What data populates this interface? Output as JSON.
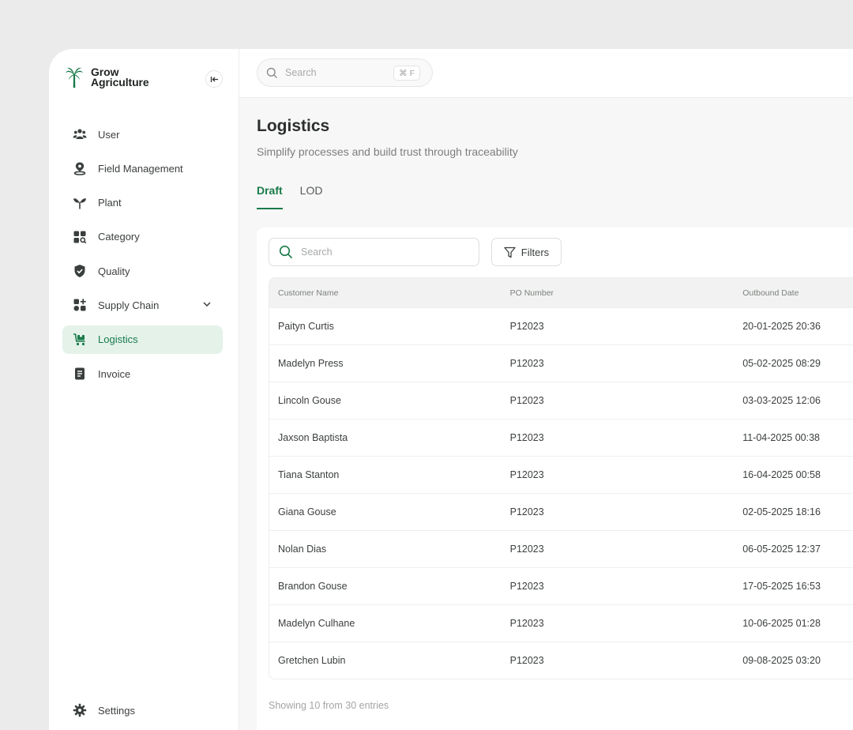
{
  "brand": {
    "line1": "Grow",
    "line2": "Agriculture"
  },
  "top_search": {
    "placeholder": "Search",
    "shortcut": "⌘ F"
  },
  "sidebar": {
    "items": [
      {
        "label": "User",
        "icon": "users-icon"
      },
      {
        "label": "Field Management",
        "icon": "map-pin-icon"
      },
      {
        "label": "Plant",
        "icon": "sprout-icon"
      },
      {
        "label": "Category",
        "icon": "category-grid-icon"
      },
      {
        "label": "Quality",
        "icon": "shield-check-icon"
      },
      {
        "label": "Supply Chain",
        "icon": "apps-add-icon",
        "has_submenu": true
      },
      {
        "label": "Logistics",
        "icon": "cart-icon",
        "active": true
      },
      {
        "label": "Invoice",
        "icon": "document-icon"
      }
    ],
    "settings_label": "Settings"
  },
  "page": {
    "title": "Logistics",
    "subtitle": "Simplify processes and build trust through traceability",
    "tabs": [
      {
        "label": "Draft",
        "active": true
      },
      {
        "label": "LOD",
        "active": false
      }
    ]
  },
  "table_controls": {
    "search_placeholder": "Search",
    "filters_label": "Filters"
  },
  "table": {
    "columns": [
      "Customer Name",
      "PO Number",
      "Outbound Date"
    ],
    "rows": [
      [
        "Paityn Curtis",
        "P12023",
        "20-01-2025 20:36"
      ],
      [
        "Madelyn Press",
        "P12023",
        "05-02-2025 08:29"
      ],
      [
        "Lincoln Gouse",
        "P12023",
        "03-03-2025 12:06"
      ],
      [
        "Jaxson Baptista",
        "P12023",
        "11-04-2025 00:38"
      ],
      [
        "Tiana Stanton",
        "P12023",
        "16-04-2025 00:58"
      ],
      [
        "Giana Gouse",
        "P12023",
        "02-05-2025 18:16"
      ],
      [
        "Nolan Dias",
        "P12023",
        "06-05-2025 12:37"
      ],
      [
        "Brandon Gouse",
        "P12023",
        "17-05-2025 16:53"
      ],
      [
        "Madelyn Culhane",
        "P12023",
        "10-06-2025 01:28"
      ],
      [
        "Gretchen Lubin",
        "P12023",
        "09-08-2025 03:20"
      ]
    ]
  },
  "footer": {
    "entries_text": "Showing 10 from 30 entries"
  },
  "colors": {
    "accent": "#1a7a4a",
    "active_bg": "#e4f2ea",
    "page_bg": "#f7f7f7"
  }
}
